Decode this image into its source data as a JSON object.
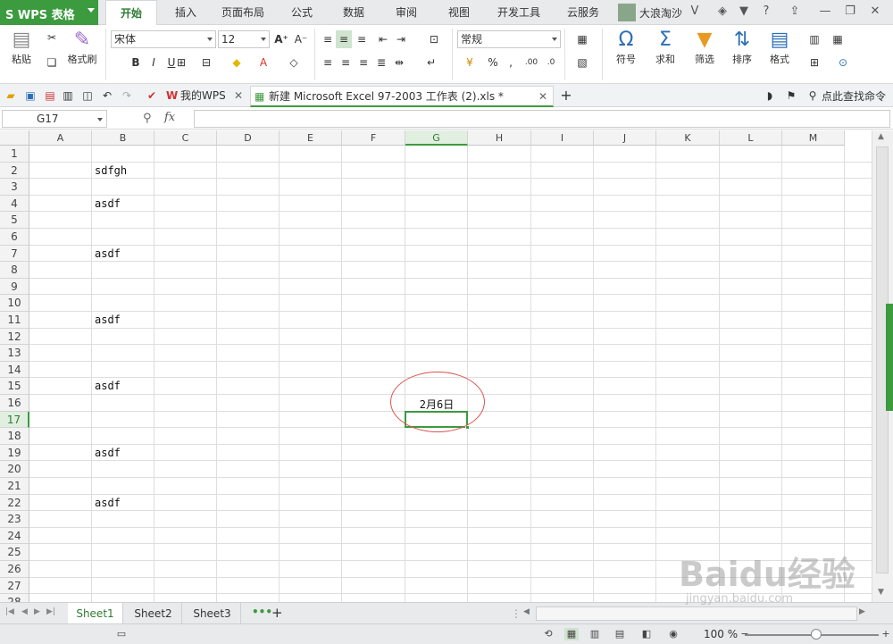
{
  "app": {
    "name": "WPS 表格",
    "user": "大浪淘沙",
    "accent": "#3c9a3f"
  },
  "menu": {
    "tabs": [
      "开始",
      "插入",
      "页面布局",
      "公式",
      "数据",
      "审阅",
      "视图",
      "开发工具",
      "云服务"
    ],
    "active": "开始"
  },
  "ribbon": {
    "paste": "粘贴",
    "format_painter": "格式刷",
    "font_name": "宋体",
    "font_size": "12",
    "bold": "B",
    "italic": "I",
    "underline": "U",
    "number_format": "常规",
    "percent": "%",
    "comma": ",",
    "symbol": "符号",
    "sum": "求和",
    "filter": "筛选",
    "sort": "排序",
    "format": "格式"
  },
  "quickbar": {
    "my_wps_tab": "我的WPS",
    "doc_tab": "新建 Microsoft Excel 97-2003 工作表 (2).xls *",
    "find_command": "点此查找命令"
  },
  "formula_bar": {
    "name_box": "G17",
    "fx": "fx",
    "value": ""
  },
  "grid": {
    "columns": [
      "A",
      "B",
      "C",
      "D",
      "E",
      "F",
      "G",
      "H",
      "I",
      "J",
      "K",
      "L",
      "M"
    ],
    "selected_column": "G",
    "rows": [
      "1",
      "2",
      "3",
      "4",
      "5",
      "6",
      "7",
      "8",
      "9",
      "10",
      "11",
      "12",
      "13",
      "14",
      "15",
      "16",
      "17",
      "18",
      "19",
      "20",
      "21",
      "22",
      "23",
      "24",
      "25",
      "26",
      "27",
      "28"
    ],
    "selected_row": "17",
    "cells": [
      {
        "ref": "B2",
        "value": "sdfgh"
      },
      {
        "ref": "B4",
        "value": "asdf"
      },
      {
        "ref": "B7",
        "value": "asdf"
      },
      {
        "ref": "B11",
        "value": "asdf"
      },
      {
        "ref": "B15",
        "value": "asdf"
      },
      {
        "ref": "G16",
        "value": "2月6日"
      },
      {
        "ref": "B19",
        "value": "asdf"
      },
      {
        "ref": "B22",
        "value": "asdf"
      }
    ]
  },
  "sheets": {
    "tabs": [
      "Sheet1",
      "Sheet2",
      "Sheet3"
    ],
    "active": "Sheet1"
  },
  "status": {
    "zoom": "100 %"
  },
  "watermark": {
    "text": "Baidu经验",
    "url": "jingyan.baidu.com"
  },
  "annotation_color": "#d9534f"
}
